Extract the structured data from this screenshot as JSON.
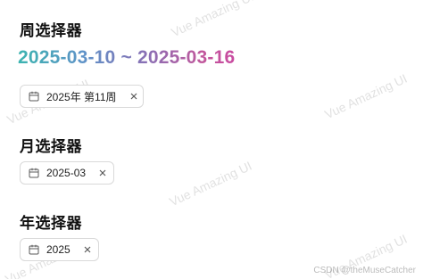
{
  "week_section": {
    "title": "周选择器",
    "range_text": "2025-03-10 ~ 2025-03-16",
    "picker_value": "2025年 第11周",
    "calendar_icon": "calendar-icon",
    "clear_icon": "close-icon"
  },
  "month_section": {
    "title": "月选择器",
    "picker_value": "2025-03",
    "calendar_icon": "calendar-icon",
    "clear_icon": "close-icon"
  },
  "year_section": {
    "title": "年选择器",
    "picker_value": "2025",
    "calendar_icon": "calendar-icon",
    "clear_icon": "close-icon"
  },
  "watermark": {
    "text": "Vue Amazing UI"
  },
  "credit": "CSDN @theMuseCatcher",
  "colors": {
    "gradient_start": "#3cb4b0",
    "gradient_end": "#c94aa0",
    "border": "#d9d9d9"
  }
}
